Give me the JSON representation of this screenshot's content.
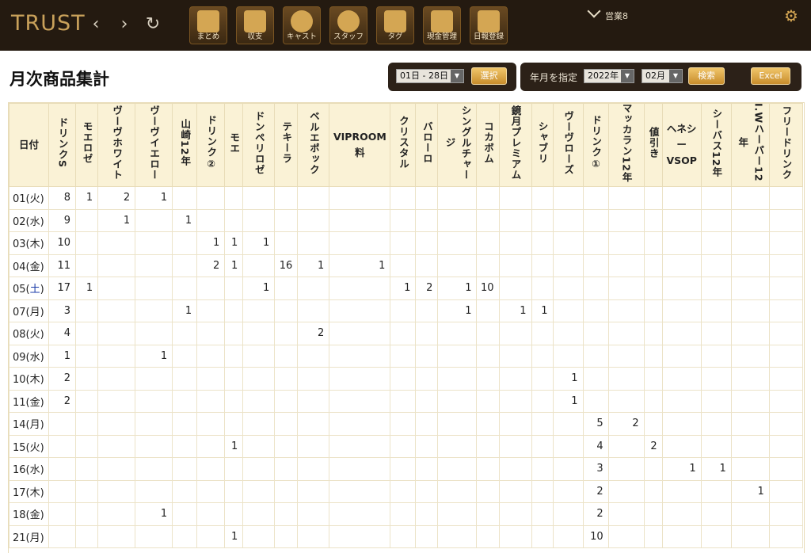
{
  "app": {
    "logo": "TRUST"
  },
  "nav": {
    "back": "‹",
    "forward": "›",
    "refresh": "↻",
    "buttons": [
      {
        "label": "まとめ",
        "icon": "clipboard-icon"
      },
      {
        "label": "収支",
        "icon": "bar-chart-icon"
      },
      {
        "label": "キャスト",
        "icon": "cast-person-icon"
      },
      {
        "label": "スタッフ",
        "icon": "staff-person-icon"
      },
      {
        "label": "タグ",
        "icon": "pen-tag-icon"
      },
      {
        "label": "現金管理",
        "icon": "cash-icon"
      },
      {
        "label": "日報登録",
        "icon": "book-icon"
      }
    ],
    "shift_label": "営業8",
    "settings_icon": "gear-icon"
  },
  "page": {
    "title": "月次商品集計",
    "range_select": "01日 - 28日",
    "select_button": "選択",
    "ym_label": "年月を指定",
    "year_select": "2022年",
    "month_select": "02月",
    "search_button": "検索",
    "excel_button": "Excel"
  },
  "table": {
    "columns": [
      "日付",
      "ドリンクS",
      "モエロゼ",
      "ヴーヴホワイト",
      "ヴーヴイエロー",
      "山崎12年",
      "ドリンク②",
      "モエ",
      "ドンペリロゼ",
      "テキーラ",
      "ベルエポック",
      "VIPROOM料",
      "クリスタル",
      "バローロ",
      "シングルチャージ",
      "コカボム",
      "鏡月プレミアム",
      "シャブリ",
      "ヴーヴローズ",
      "ドリンク①",
      "マッカラン12年",
      "値引き",
      "ヘネシーVSOP",
      "シーバス12年",
      "I.Wハーパー12年",
      "フリードリンク"
    ],
    "rows": [
      [
        "01(火)",
        "8",
        "1",
        "2",
        "1",
        "",
        "",
        "",
        "",
        "",
        "",
        "",
        "",
        "",
        "",
        "",
        "",
        "",
        "",
        "",
        "",
        "",
        "",
        "",
        "",
        ""
      ],
      [
        "02(水)",
        "9",
        "",
        "1",
        "",
        "1",
        "",
        "",
        "",
        "",
        "",
        "",
        "",
        "",
        "",
        "",
        "",
        "",
        "",
        "",
        "",
        "",
        "",
        "",
        "",
        ""
      ],
      [
        "03(木)",
        "10",
        "",
        "",
        "",
        "",
        "1",
        "1",
        "1",
        "",
        "",
        "",
        "",
        "",
        "",
        "",
        "",
        "",
        "",
        "",
        "",
        "",
        "",
        "",
        "",
        ""
      ],
      [
        "04(金)",
        "11",
        "",
        "",
        "",
        "",
        "2",
        "1",
        "",
        "16",
        "1",
        "1",
        "",
        "",
        "",
        "",
        "",
        "",
        "",
        "",
        "",
        "",
        "",
        "",
        "",
        ""
      ],
      [
        "05(土)",
        "17",
        "1",
        "",
        "",
        "",
        "",
        "",
        "1",
        "",
        "",
        "",
        "1",
        "2",
        "1",
        "10",
        "",
        "",
        "",
        "",
        "",
        "",
        "",
        "",
        "",
        ""
      ],
      [
        "07(月)",
        "3",
        "",
        "",
        "",
        "1",
        "",
        "",
        "",
        "",
        "",
        "",
        "",
        "",
        "1",
        "",
        "1",
        "1",
        "",
        "",
        "",
        "",
        "",
        "",
        "",
        ""
      ],
      [
        "08(火)",
        "4",
        "",
        "",
        "",
        "",
        "",
        "",
        "",
        "",
        "2",
        "",
        "",
        "",
        "",
        "",
        "",
        "",
        "",
        "",
        "",
        "",
        "",
        "",
        "",
        ""
      ],
      [
        "09(水)",
        "1",
        "",
        "",
        "1",
        "",
        "",
        "",
        "",
        "",
        "",
        "",
        "",
        "",
        "",
        "",
        "",
        "",
        "",
        "",
        "",
        "",
        "",
        "",
        "",
        ""
      ],
      [
        "10(木)",
        "2",
        "",
        "",
        "",
        "",
        "",
        "",
        "",
        "",
        "",
        "",
        "",
        "",
        "",
        "",
        "",
        "",
        "1",
        "",
        "",
        "",
        "",
        "",
        "",
        ""
      ],
      [
        "11(金)",
        "2",
        "",
        "",
        "",
        "",
        "",
        "",
        "",
        "",
        "",
        "",
        "",
        "",
        "",
        "",
        "",
        "",
        "1",
        "",
        "",
        "",
        "",
        "",
        "",
        ""
      ],
      [
        "14(月)",
        "",
        "",
        "",
        "",
        "",
        "",
        "",
        "",
        "",
        "",
        "",
        "",
        "",
        "",
        "",
        "",
        "",
        "",
        "5",
        "2",
        "",
        "",
        "",
        "",
        ""
      ],
      [
        "15(火)",
        "",
        "",
        "",
        "",
        "",
        "",
        "1",
        "",
        "",
        "",
        "",
        "",
        "",
        "",
        "",
        "",
        "",
        "",
        "4",
        "",
        "2",
        "",
        "",
        "",
        ""
      ],
      [
        "16(水)",
        "",
        "",
        "",
        "",
        "",
        "",
        "",
        "",
        "",
        "",
        "",
        "",
        "",
        "",
        "",
        "",
        "",
        "",
        "3",
        "",
        "",
        "1",
        "1",
        "",
        ""
      ],
      [
        "17(木)",
        "",
        "",
        "",
        "",
        "",
        "",
        "",
        "",
        "",
        "",
        "",
        "",
        "",
        "",
        "",
        "",
        "",
        "",
        "2",
        "",
        "",
        "",
        "",
        "1",
        ""
      ],
      [
        "18(金)",
        "",
        "",
        "",
        "1",
        "",
        "",
        "",
        "",
        "",
        "",
        "",
        "",
        "",
        "",
        "",
        "",
        "",
        "",
        "2",
        "",
        "",
        "",
        "",
        "",
        ""
      ],
      [
        "21(月)",
        "",
        "",
        "",
        "",
        "",
        "",
        "1",
        "",
        "",
        "",
        "",
        "",
        "",
        "",
        "",
        "",
        "",
        "",
        "10",
        "",
        "",
        "",
        "",
        "",
        ""
      ]
    ]
  }
}
